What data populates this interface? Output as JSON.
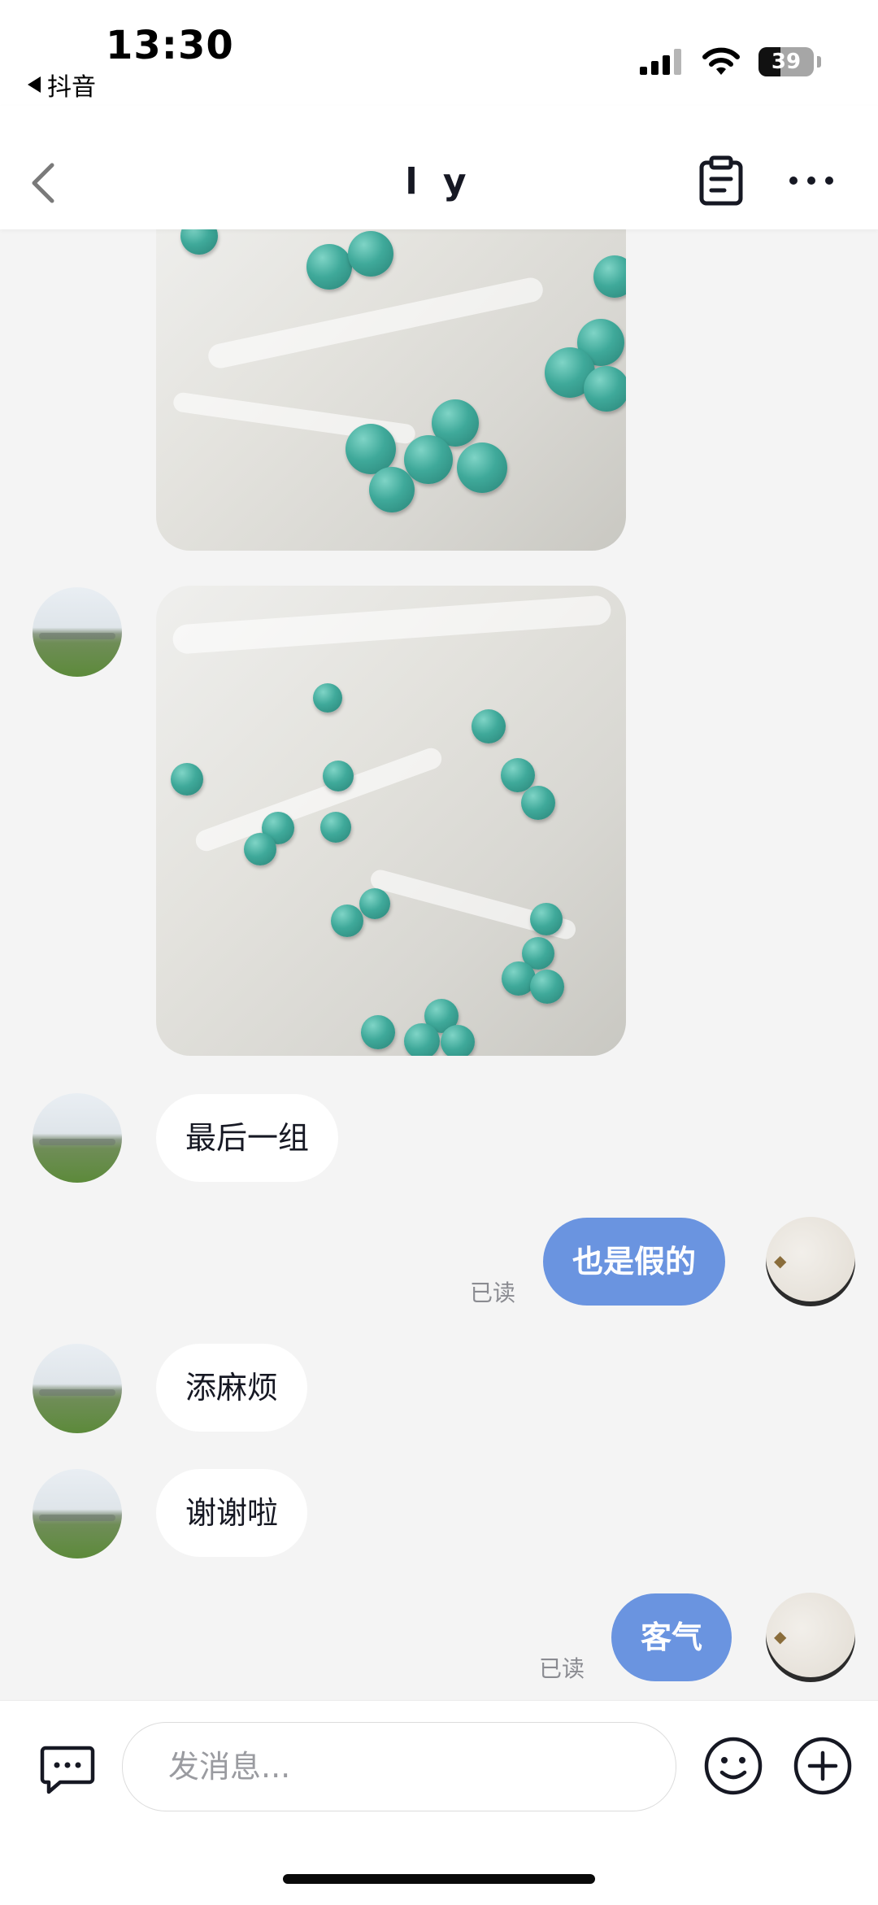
{
  "status_bar": {
    "time": "13:30",
    "back_app": "抖音",
    "battery": "39",
    "battery_level": 0.39
  },
  "nav": {
    "title": "l y",
    "icons": [
      "chevron-left-icon",
      "clipboard-icon",
      "more-icon"
    ]
  },
  "messages": [
    {
      "side": "left",
      "type": "image",
      "description_icon": "beads-photo"
    },
    {
      "side": "left",
      "type": "image",
      "description_icon": "beads-photo"
    },
    {
      "side": "left",
      "type": "text",
      "text": "最后一组"
    },
    {
      "side": "right",
      "type": "text",
      "text": "也是假的",
      "status": "已读"
    },
    {
      "side": "left",
      "type": "text",
      "text": "添麻烦"
    },
    {
      "side": "left",
      "type": "text",
      "text": "谢谢啦"
    },
    {
      "side": "right",
      "type": "text",
      "text": "客气",
      "status": "已读"
    }
  ],
  "input": {
    "placeholder": "发消息..."
  },
  "colors": {
    "accent": "#6a94e0",
    "background": "#f4f4f4",
    "bubble_left": "#ffffff",
    "read_text": "#8a8b91"
  }
}
